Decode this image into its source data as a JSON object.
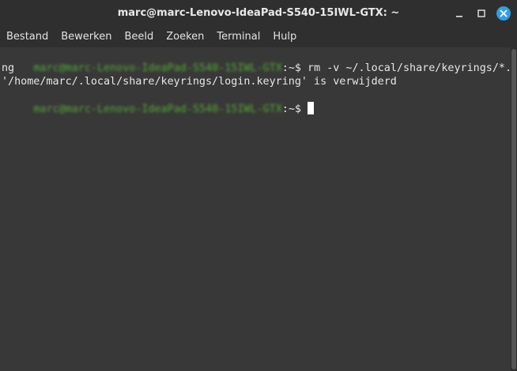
{
  "window": {
    "title": "marc@marc-Lenovo-IdeaPad-S540-15IWL-GTX: ~"
  },
  "controls": {
    "minimize_icon": "minimize-icon",
    "maximize_icon": "maximize-icon",
    "close_icon": "close-icon",
    "close_color": "#2f9ee6"
  },
  "menu": {
    "items": [
      "Bestand",
      "Bewerken",
      "Beeld",
      "Zoeken",
      "Terminal",
      "Hulp"
    ]
  },
  "terminal": {
    "prompt_user": "marc@marc-Lenovo-IdeaPad-S540-15IWL-GTX",
    "prompt_suffix": ":~$ ",
    "lines": [
      {
        "command": "rm -v ~/.local/share/keyrings/*.keyri"
      },
      {
        "output": "ng"
      },
      {
        "output": "'/home/marc/.local/share/keyrings/login.keyring' is verwijderd"
      }
    ],
    "prompt_color": "#56a836"
  }
}
